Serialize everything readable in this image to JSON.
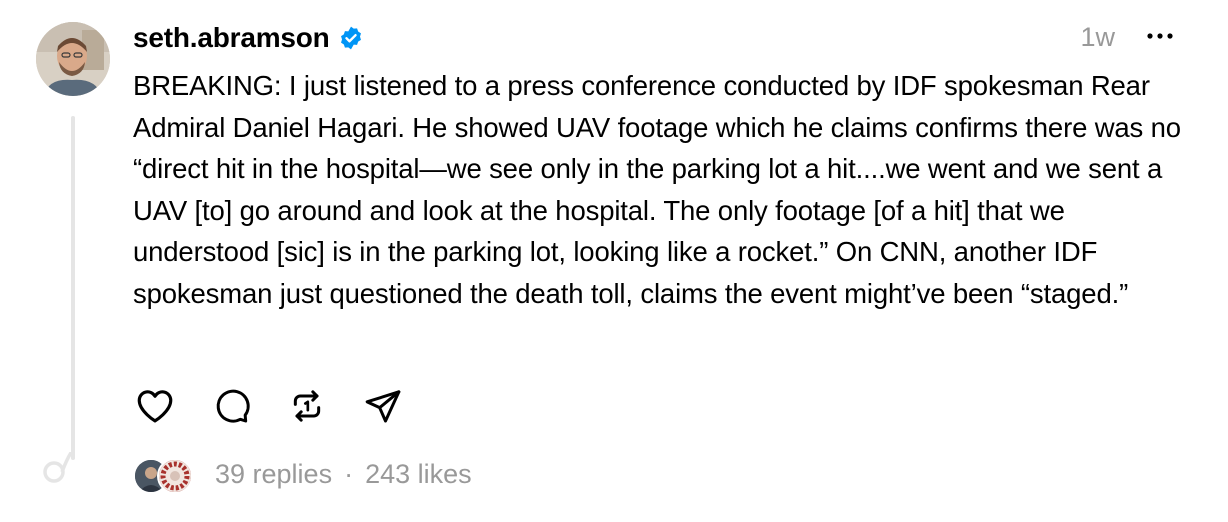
{
  "post": {
    "username": "seth.abramson",
    "verified": true,
    "timestamp": "1w",
    "text": "BREAKING: I just listened to a press conference conducted by IDF spokesman Rear Admiral Daniel Hagari. He showed UAV footage which he claims confirms there was no “direct hit in the hospital—we see only in the parking lot a hit....we went and we sent a UAV [to] go around and look at the hospital. The only footage [of a hit] that we understood [sic] is in the parking lot, looking like a rocket.” On CNN, another IDF spokesman just questioned the death toll, claims the event might’ve been “staged.”",
    "replies": "39 replies",
    "separator": "·",
    "likes": "243 likes"
  },
  "icons": {
    "verified": "verified-badge-icon",
    "more": "more-options-icon",
    "like": "heart-icon",
    "reply": "comment-icon",
    "repost": "repost-icon",
    "share": "share-icon"
  },
  "colors": {
    "verified": "#0095f6",
    "muted": "#999999",
    "thread_line": "#e5e5e5"
  }
}
